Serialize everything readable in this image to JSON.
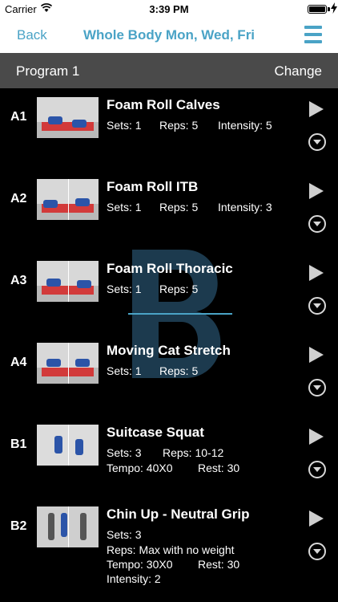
{
  "status_bar": {
    "carrier": "Carrier",
    "time": "3:39 PM"
  },
  "nav": {
    "back_label": "Back",
    "title": "Whole Body Mon, Wed, Fri"
  },
  "program": {
    "name": "Program 1",
    "change_label": "Change"
  },
  "exercises": [
    {
      "code": "A1",
      "name": "Foam Roll Calves",
      "sets": "Sets: 1",
      "reps": "Reps: 5",
      "intensity": "Intensity: 5"
    },
    {
      "code": "A2",
      "name": "Foam Roll ITB",
      "sets": "Sets: 1",
      "reps": "Reps: 5",
      "intensity": "Intensity: 3"
    },
    {
      "code": "A3",
      "name": "Foam Roll Thoracic",
      "sets": "Sets: 1",
      "reps": "Reps: 5"
    },
    {
      "code": "A4",
      "name": "Moving Cat Stretch",
      "sets": "Sets: 1",
      "reps": "Reps: 5"
    },
    {
      "code": "B1",
      "name": "Suitcase Squat",
      "sets": "Sets: 3",
      "reps": "Reps: 10-12",
      "tempo": "Tempo: 40X0",
      "rest": "Rest: 30"
    },
    {
      "code": "B2",
      "name": "Chin Up - Neutral Grip",
      "sets": "Sets: 3",
      "reps": "Reps: Max with no weight",
      "tempo": "Tempo: 30X0",
      "rest": "Rest: 30",
      "intensity": "Intensity: 2"
    }
  ],
  "colors": {
    "accent": "#4aa3c6",
    "program_bar": "#4a4a4a",
    "background": "#000000"
  }
}
